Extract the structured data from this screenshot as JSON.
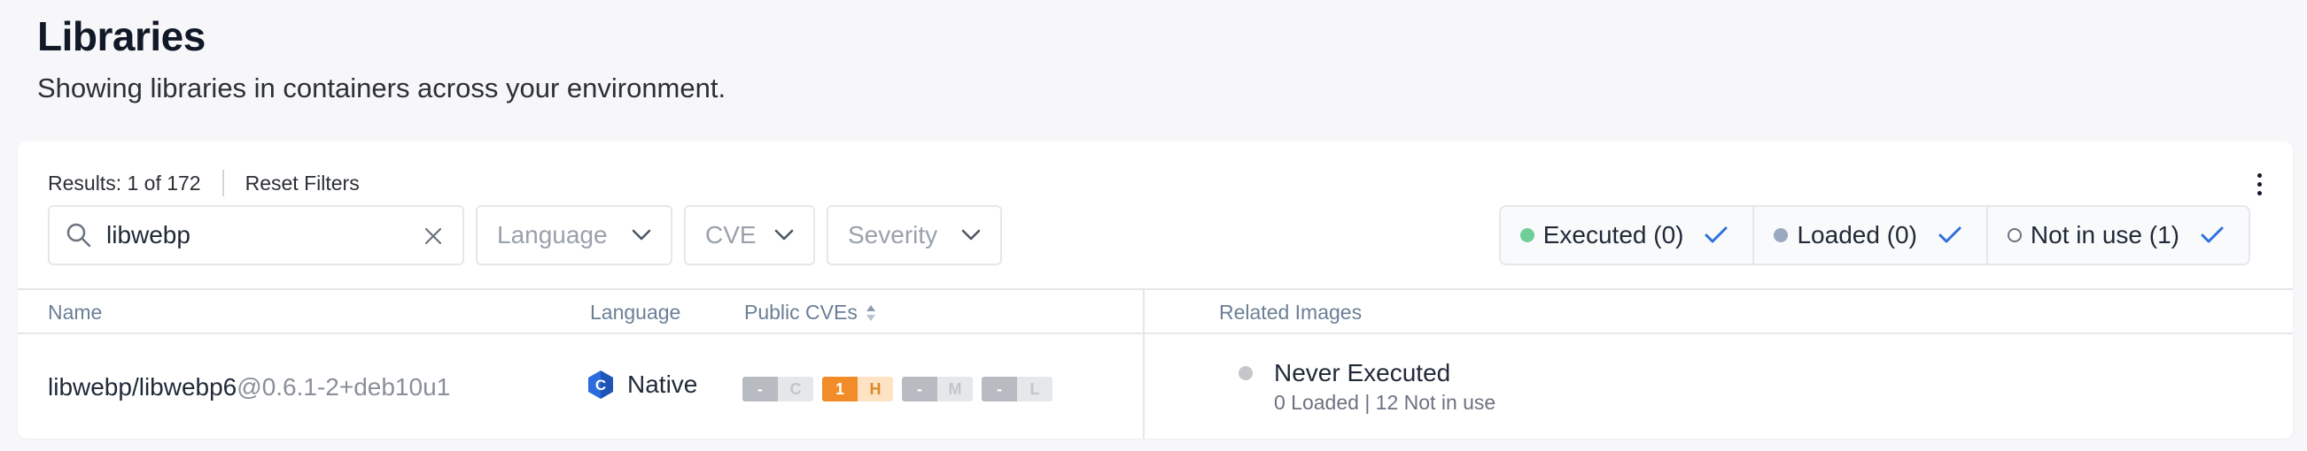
{
  "page": {
    "title": "Libraries",
    "subtitle": "Showing libraries in containers across your environment."
  },
  "toolbar": {
    "results_text": "Results: 1 of 172",
    "reset_label": "Reset Filters",
    "more_icon": "kebab-vertical-icon"
  },
  "filters": {
    "search_value": "libwebp",
    "search_icon": "search-icon",
    "clear_icon": "close-icon",
    "language_placeholder": "Language",
    "cve_placeholder": "CVE",
    "severity_placeholder": "Severity"
  },
  "toggles": [
    {
      "label": "Executed (0)",
      "color": "#6fcf97",
      "checked": true
    },
    {
      "label": "Loaded (0)",
      "color": "#9aa8c2",
      "checked": true
    },
    {
      "label": "Not in use (1)",
      "color": "#ffffff",
      "checked": true
    }
  ],
  "table": {
    "headers": {
      "name": "Name",
      "language": "Language",
      "public_cves": "Public CVEs",
      "related_images": "Related Images"
    },
    "rows": [
      {
        "name": "libwebp/libwebp6",
        "version": "@0.6.1-2+deb10u1",
        "language": "Native",
        "cves": [
          {
            "count": "-",
            "level": "C"
          },
          {
            "count": "1",
            "level": "H"
          },
          {
            "count": "-",
            "level": "M"
          },
          {
            "count": "-",
            "level": "L"
          }
        ],
        "images_status": "Never Executed",
        "images_detail": "0 Loaded | 12 Not in use"
      }
    ]
  },
  "colors": {
    "check": "#2f6fde",
    "high": "#f28c28",
    "high_light": "#fde3c3",
    "none": "#b8bcc2",
    "none_light": "#e6e7ea",
    "native_icon": "#2d6cdf"
  }
}
